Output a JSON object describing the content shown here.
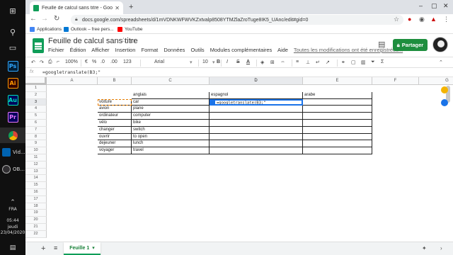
{
  "taskbar": {
    "items": [
      {
        "name": "windows-start",
        "glyph": "⊞"
      },
      {
        "name": "search",
        "glyph": "⚲"
      },
      {
        "name": "task-view",
        "glyph": "▭"
      }
    ],
    "apps": [
      {
        "label": "Ps",
        "color": "#31a8ff",
        "bg": "#001e36"
      },
      {
        "label": "Ai",
        "color": "#ff9a00",
        "bg": "#330000"
      },
      {
        "label": "Au",
        "color": "#00e4bb",
        "bg": "#00005b"
      },
      {
        "label": "Pr",
        "color": "#ea77ff",
        "bg": "#00005b"
      }
    ],
    "running": [
      {
        "label": "Vid...",
        "icon": "film-icon"
      },
      {
        "label": "OB...",
        "icon": "obs-icon"
      }
    ],
    "lang": "FRA",
    "time": "05:44",
    "day": "jeudi",
    "date": "23/04/2020"
  },
  "browser": {
    "tab_title": "Feuille de calcul sans titre - Goo",
    "url": "docs.google.com/spreadsheets/d/1mVDNKWFWVKZxtvalp8508YTMZlaZroTuge8IK5_UAnc/edit#gid=0",
    "bookmarks": [
      "Applications",
      "Outlook – free pers...",
      "YouTube"
    ],
    "bookmark_colors": [
      "#4285f4",
      "#0078d4",
      "#ff0000"
    ]
  },
  "sheets": {
    "title": "Feuille de calcul sans titre",
    "menu": [
      "Fichier",
      "Édition",
      "Afficher",
      "Insertion",
      "Format",
      "Données",
      "Outils",
      "Modules complémentaires",
      "Aide"
    ],
    "saved_status": "Toutes les modifications ont été enregistrées...",
    "share_label": "Partager",
    "toolbar": {
      "zoom": "100%",
      "currency": "€",
      "percent": "%",
      "dec1": ".0",
      "dec2": ".00",
      "numfmt": "123",
      "font": "Arial",
      "size": "10",
      "bold": "B",
      "italic": "I",
      "strike": "S",
      "text_color": "A"
    },
    "formula_bar": {
      "fx": "fx",
      "content": "=googletranslate(B3;\""
    },
    "sheet_tab": "Feuille 1",
    "accent": "#0f9d58"
  },
  "grid": {
    "columns": [
      "A",
      "B",
      "C",
      "D",
      "E",
      "F",
      "G"
    ],
    "selected_column": "D",
    "rows": [
      "1",
      "2",
      "3",
      "4",
      "5",
      "6",
      "7",
      "8",
      "9",
      "10",
      "11",
      "12",
      "13",
      "14",
      "15",
      "16",
      "17",
      "18",
      "19",
      "20",
      "21",
      "22"
    ],
    "selected_row": "3",
    "headers": {
      "C": "anglais",
      "D": "espagnol",
      "E": "arabe"
    },
    "words": [
      {
        "fr": "voiture",
        "en": "car"
      },
      {
        "fr": "avion",
        "en": "plane"
      },
      {
        "fr": "ordinateur",
        "en": "computer"
      },
      {
        "fr": "vélo",
        "en": "bike"
      },
      {
        "fr": "changer",
        "en": "switch"
      },
      {
        "fr": "ouvrir",
        "en": "to open"
      },
      {
        "fr": "dejeuner",
        "en": "lunch"
      },
      {
        "fr": "voyager",
        "en": "travel"
      }
    ],
    "active_cell_text": "=googletranslate(B3;\""
  }
}
